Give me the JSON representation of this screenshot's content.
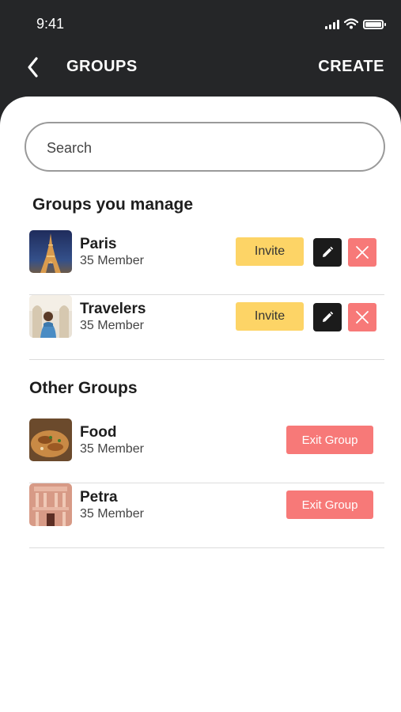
{
  "status_bar": {
    "time": "9:41"
  },
  "nav": {
    "title": "GROUPS",
    "create_label": "CREATE"
  },
  "search": {
    "placeholder": "Search",
    "value": ""
  },
  "managed_section": {
    "title": "Groups you manage",
    "groups": [
      {
        "name": "Paris",
        "members": "35 Member",
        "invite_label": "Invite",
        "image": "eiffel-tower-at-night"
      },
      {
        "name": "Travelers",
        "members": "35 Member",
        "invite_label": "Invite",
        "image": "traveler-photo"
      }
    ]
  },
  "other_section": {
    "title": "Other Groups",
    "groups": [
      {
        "name": "Food",
        "members": "35 Member",
        "exit_label": "Exit Group",
        "image": "food-dish"
      },
      {
        "name": "Petra",
        "members": "35 Member",
        "exit_label": "Exit Group",
        "image": "petra-treasury"
      }
    ]
  },
  "colors": {
    "header_bg": "#252628",
    "invite_bg": "#fdd466",
    "edit_bg": "#1b1b1b",
    "danger_bg": "#f77978"
  }
}
